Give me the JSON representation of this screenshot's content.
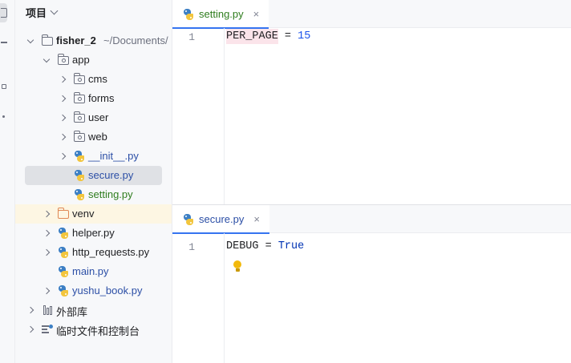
{
  "project_panel": {
    "title": "项目",
    "tree": [
      {
        "label": "fisher_2",
        "hint": "~/Documents/",
        "depth": 0,
        "arrow": "down",
        "icon": "folder-icon",
        "style": "bold"
      },
      {
        "label": "app",
        "depth": 1,
        "arrow": "down",
        "icon": "package-folder-icon",
        "style": "normal"
      },
      {
        "label": "cms",
        "depth": 2,
        "arrow": "right",
        "icon": "package-folder-icon",
        "style": "normal"
      },
      {
        "label": "forms",
        "depth": 2,
        "arrow": "right",
        "icon": "package-folder-icon",
        "style": "normal"
      },
      {
        "label": "user",
        "depth": 2,
        "arrow": "right",
        "icon": "package-folder-icon",
        "style": "normal"
      },
      {
        "label": "web",
        "depth": 2,
        "arrow": "right",
        "icon": "package-folder-icon",
        "style": "normal"
      },
      {
        "label": "__init__.py",
        "depth": 2,
        "arrow": "right",
        "icon": "python-file-icon",
        "style": "blue"
      },
      {
        "label": "secure.py",
        "depth": 2,
        "arrow": "none",
        "icon": "python-file-icon",
        "style": "blue",
        "selected": true
      },
      {
        "label": "setting.py",
        "depth": 2,
        "arrow": "none",
        "icon": "python-file-icon",
        "style": "green"
      },
      {
        "label": "venv",
        "depth": 1,
        "arrow": "right",
        "icon": "excluded-folder-icon",
        "style": "normal",
        "highlighted": true
      },
      {
        "label": "helper.py",
        "depth": 1,
        "arrow": "right",
        "icon": "python-file-icon",
        "style": "normal"
      },
      {
        "label": "http_requests.py",
        "depth": 1,
        "arrow": "right",
        "icon": "python-file-icon",
        "style": "normal"
      },
      {
        "label": "main.py",
        "depth": 1,
        "arrow": "none",
        "icon": "python-file-icon",
        "style": "blue"
      },
      {
        "label": "yushu_book.py",
        "depth": 1,
        "arrow": "right",
        "icon": "python-file-icon",
        "style": "blue"
      },
      {
        "label": "外部库",
        "depth": 0,
        "arrow": "right",
        "icon": "library-icon",
        "style": "normal"
      },
      {
        "label": "临时文件和控制台",
        "depth": 0,
        "arrow": "right",
        "icon": "scratch-icon",
        "style": "normal"
      }
    ]
  },
  "editor_top": {
    "tab": {
      "label": "setting.py",
      "close": "×"
    },
    "lines": [
      {
        "number": "1",
        "name": "PER_PAGE",
        "op": " = ",
        "value": "15"
      }
    ]
  },
  "editor_bottom": {
    "tab": {
      "label": "secure.py",
      "close": "×"
    },
    "lines": [
      {
        "number": "1",
        "name": "DEBUG",
        "op": " = ",
        "value": "True"
      }
    ]
  },
  "colors": {
    "accent": "#3574f0",
    "selection": "#dfe1e5",
    "modified_file": "#2f7d1e",
    "vcs_file": "#2c4fa6",
    "highlight_row": "#fdf6e3"
  }
}
